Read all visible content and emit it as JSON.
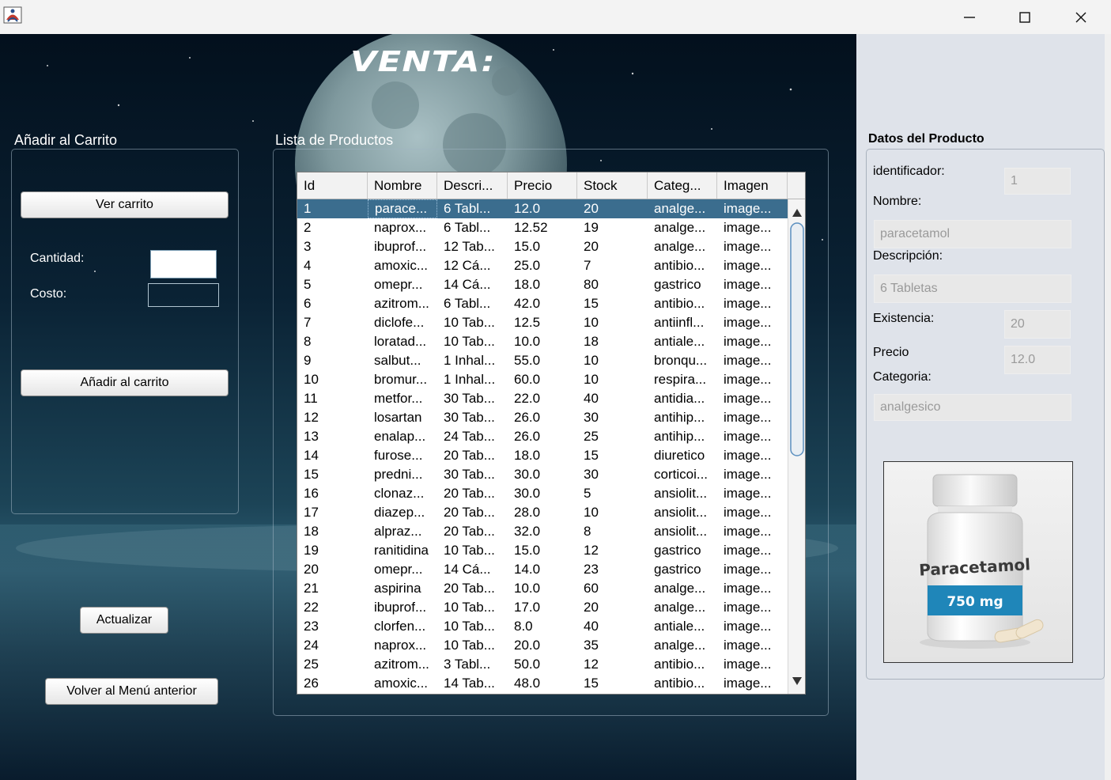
{
  "window": {
    "controls": {
      "minimize": "minimize-icon",
      "maximize": "maximize-icon",
      "close": "close-icon"
    }
  },
  "header": {
    "title": "VENTA:"
  },
  "cart_panel": {
    "label": "Añadir al Carrito",
    "view_cart_button": "Ver carrito",
    "quantity_label": "Cantidad:",
    "quantity_value": "",
    "cost_label": "Costo:",
    "cost_value": "",
    "add_button": "Añadir al carrito"
  },
  "actions": {
    "refresh_button": "Actualizar",
    "back_button": "Volver al Menú anterior"
  },
  "products_panel": {
    "label": "Lista de Productos",
    "columns": [
      "Id",
      "Nombre",
      "Descri...",
      "Precio",
      "Stock",
      "Categ...",
      "Imagen"
    ],
    "selected_row": 1,
    "rows": [
      [
        "1",
        "parace...",
        "6 Tabl...",
        "12.0",
        "20",
        "analge...",
        "image..."
      ],
      [
        "2",
        "naprox...",
        "6 Tabl...",
        "12.52",
        "19",
        "analge...",
        "image..."
      ],
      [
        "3",
        "ibuprof...",
        "12 Tab...",
        "15.0",
        "20",
        "analge...",
        "image..."
      ],
      [
        "4",
        "amoxic...",
        "12 Cá...",
        "25.0",
        "7",
        "antibio...",
        "image..."
      ],
      [
        "5",
        "omepr...",
        "14 Cá...",
        "18.0",
        "80",
        "gastrico",
        "image..."
      ],
      [
        "6",
        "azitrom...",
        "6 Tabl...",
        "42.0",
        "15",
        "antibio...",
        "image..."
      ],
      [
        "7",
        "diclofe...",
        "10 Tab...",
        "12.5",
        "10",
        "antiinfl...",
        "image..."
      ],
      [
        "8",
        "loratad...",
        "10 Tab...",
        "10.0",
        "18",
        "antiale...",
        "image..."
      ],
      [
        "9",
        "salbut...",
        "1 Inhal...",
        "55.0",
        "10",
        "bronqu...",
        "image..."
      ],
      [
        "10",
        "bromur...",
        "1 Inhal...",
        "60.0",
        "10",
        "respira...",
        "image..."
      ],
      [
        "11",
        "metfor...",
        "30 Tab...",
        "22.0",
        "40",
        "antidia...",
        "image..."
      ],
      [
        "12",
        "losartan",
        "30 Tab...",
        "26.0",
        "30",
        "antihip...",
        "image..."
      ],
      [
        "13",
        "enalap...",
        "24 Tab...",
        "26.0",
        "25",
        "antihip...",
        "image..."
      ],
      [
        "14",
        "furose...",
        "20 Tab...",
        "18.0",
        "15",
        "diuretico",
        "image..."
      ],
      [
        "15",
        "predni...",
        "30 Tab...",
        "30.0",
        "30",
        "corticoi...",
        "image..."
      ],
      [
        "16",
        "clonaz...",
        "20 Tab...",
        "30.0",
        "5",
        "ansiolit...",
        "image..."
      ],
      [
        "17",
        "diazep...",
        "20 Tab...",
        "28.0",
        "10",
        "ansiolit...",
        "image..."
      ],
      [
        "18",
        "alpraz...",
        "20 Tab...",
        "32.0",
        "8",
        "ansiolit...",
        "image..."
      ],
      [
        "19",
        "ranitidina",
        "10 Tab...",
        "15.0",
        "12",
        "gastrico",
        "image..."
      ],
      [
        "20",
        "omepr...",
        "14 Cá...",
        "14.0",
        "23",
        "gastrico",
        "image..."
      ],
      [
        "21",
        "aspirina",
        "20 Tab...",
        "10.0",
        "60",
        "analge...",
        "image..."
      ],
      [
        "22",
        "ibuprof...",
        "10 Tab...",
        "17.0",
        "20",
        "analge...",
        "image..."
      ],
      [
        "23",
        "clorfen...",
        "10 Tab...",
        "8.0",
        "40",
        "antiale...",
        "image..."
      ],
      [
        "24",
        "naprox...",
        "10 Tab...",
        "20.0",
        "35",
        "analge...",
        "image..."
      ],
      [
        "25",
        "azitrom...",
        "3 Tabl...",
        "50.0",
        "12",
        "antibio...",
        "image..."
      ],
      [
        "26",
        "amoxic...",
        "14 Tab...",
        "48.0",
        "15",
        "antibio...",
        "image..."
      ]
    ]
  },
  "details_panel": {
    "title": "Datos del Producto",
    "id_label": "identificador:",
    "id_value": "1",
    "name_label": "Nombre:",
    "name_value": "paracetamol",
    "desc_label": "Descripción:",
    "desc_value": "6 Tabletas",
    "stock_label": "Existencia:",
    "stock_value": "20",
    "price_label": "Precio",
    "price_value": "12.0",
    "category_label": "Categoria:",
    "category_value": "analgesico",
    "image": {
      "brand": "Paracetamol",
      "dose": "750 mg"
    }
  }
}
